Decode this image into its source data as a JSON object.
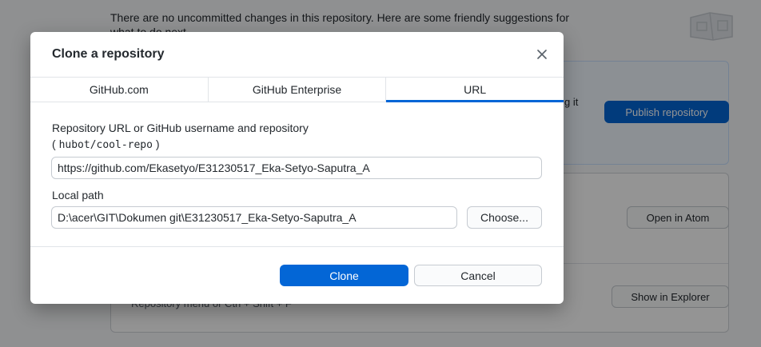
{
  "background": {
    "message_line1": "There are no uncommitted changes in this repository. Here are some friendly suggestions for",
    "message_line2": "what to do next.",
    "fragment_text": "g it",
    "publish_button": "Publish repository",
    "open_editor_button": "Open in Atom",
    "show_explorer_button": "Show in Explorer",
    "repo_menu_hint": "Repository menu or  Ctrl + Shift + F"
  },
  "dialog": {
    "title": "Clone a repository",
    "tabs": [
      {
        "label": "GitHub.com",
        "active": false
      },
      {
        "label": "GitHub Enterprise",
        "active": false
      },
      {
        "label": "URL",
        "active": true
      }
    ],
    "url_field": {
      "label": "Repository URL or GitHub username and repository",
      "hint_open": "( ",
      "hint_code": "hubot/cool-repo",
      "hint_close": " )",
      "value": "https://github.com/Ekasetyo/E31230517_Eka-Setyo-Saputra_A"
    },
    "path_field": {
      "label": "Local path",
      "value": "D:\\acer\\GIT\\Dokumen git\\E31230517_Eka-Setyo-Saputra_A",
      "choose_label": "Choose..."
    },
    "clone_label": "Clone",
    "cancel_label": "Cancel"
  },
  "colors": {
    "accent": "#0366d6",
    "border": "#c6cbd1"
  },
  "icons": {
    "close": "close-icon",
    "illustration": "empty-repo-illustration"
  }
}
